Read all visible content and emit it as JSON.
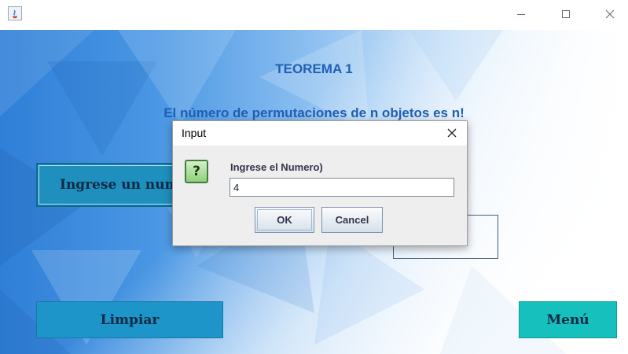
{
  "window": {
    "icons": {
      "app": "java-app-icon",
      "minimize": "minimize-icon",
      "maximize": "maximize-icon",
      "close": "close-icon"
    }
  },
  "main": {
    "heading": "TEOREMA 1",
    "subheading": "El número de permutaciones de n objetos es n!",
    "entry_button_label": "Ingrese un num",
    "result_value": "",
    "clear_button_label": "Limpiar",
    "menu_button_label": "Menú"
  },
  "dialog": {
    "title": "Input",
    "icon": "question-icon",
    "question_glyph": "?",
    "prompt": "Ingrese el Numero)",
    "input_value": "4",
    "ok_label": "OK",
    "cancel_label": "Cancel"
  },
  "colors": {
    "heading_text": "#1f5fb4",
    "entry_button_bg": "#1f8fbe",
    "clear_button_bg": "#1d95c8",
    "menu_button_bg": "#16c0bd"
  }
}
